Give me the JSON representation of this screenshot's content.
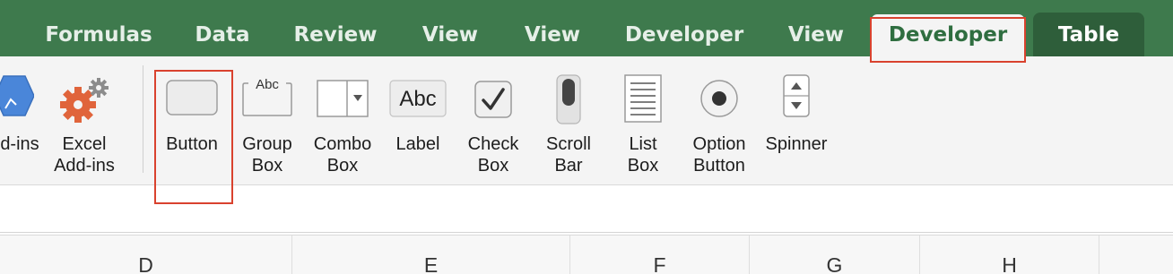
{
  "tabs": [
    {
      "label": "Formulas"
    },
    {
      "label": "Data"
    },
    {
      "label": "Review"
    },
    {
      "label": "View"
    },
    {
      "label": "View"
    },
    {
      "label": "Developer"
    },
    {
      "label": "View"
    },
    {
      "label": "Developer",
      "active": true
    },
    {
      "label": "Table"
    }
  ],
  "ribbon": {
    "controls": [
      {
        "label": "d-ins",
        "icon": "add-ins-hexagon-icon"
      },
      {
        "label": "Excel\nAdd-ins",
        "icon": "excel-add-ins-gear-icon"
      },
      {
        "label": "Button",
        "icon": "button-control-icon"
      },
      {
        "label": "Group\nBox",
        "icon": "group-box-icon",
        "icon_text": "Abc"
      },
      {
        "label": "Combo\nBox",
        "icon": "combo-box-icon"
      },
      {
        "label": "Label",
        "icon": "label-control-icon",
        "icon_text": "Abc"
      },
      {
        "label": "Check\nBox",
        "icon": "check-box-icon"
      },
      {
        "label": "Scroll\nBar",
        "icon": "scroll-bar-icon"
      },
      {
        "label": "List\nBox",
        "icon": "list-box-icon"
      },
      {
        "label": "Option\nButton",
        "icon": "option-button-icon"
      },
      {
        "label": "Spinner",
        "icon": "spinner-icon"
      }
    ]
  },
  "columns": [
    "D",
    "E",
    "F",
    "G",
    "H"
  ],
  "colors": {
    "tab_bar": "#3e7a4d",
    "active_tab_text": "#2f6e40",
    "highlight": "#d9422e"
  }
}
